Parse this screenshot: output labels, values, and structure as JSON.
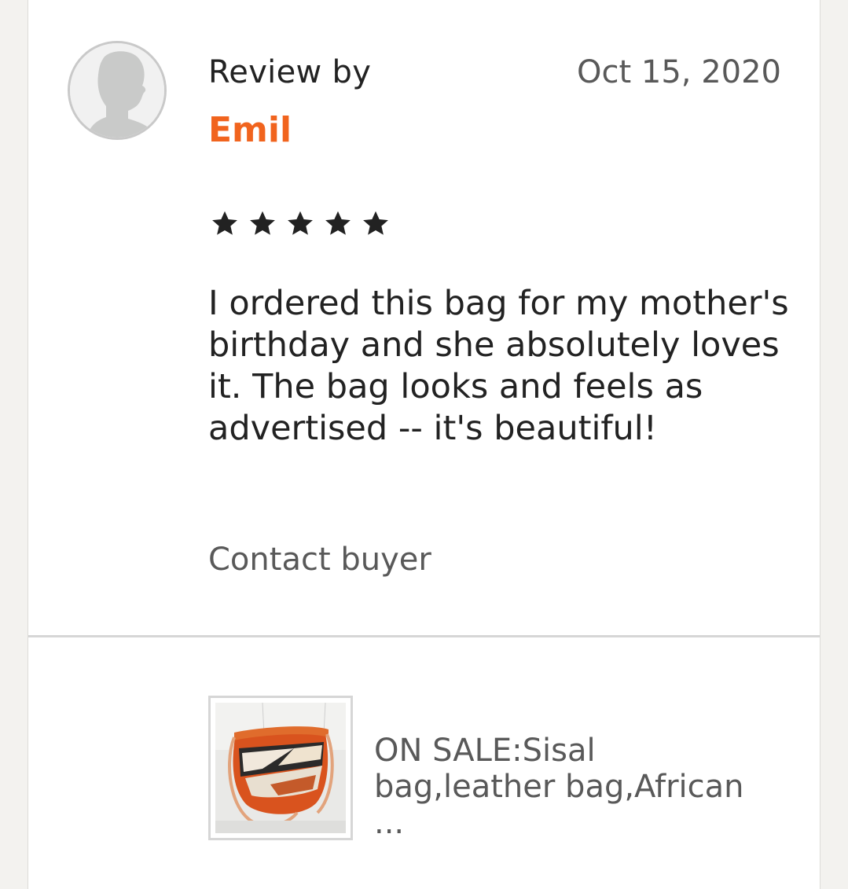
{
  "review": {
    "header_label": "Review by",
    "date": "Oct 15, 2020",
    "reviewer_name": "Emil",
    "rating": 5,
    "rating_max": 5,
    "body": "I ordered this bag for my mother's birthday and she absolutely loves it. The bag looks and feels as advertised -- it's beautiful!",
    "contact_label": "Contact buyer"
  },
  "product": {
    "title_line1": "ON SALE:Sisal",
    "title_line2": "bag,leather bag,African ..."
  },
  "colors": {
    "accent": "#f1641e",
    "text_primary": "#222222",
    "text_secondary": "#595959",
    "divider": "#d6d6d6"
  },
  "icons": {
    "avatar": "default-user-silhouette-icon",
    "star": "filled-star-icon"
  }
}
